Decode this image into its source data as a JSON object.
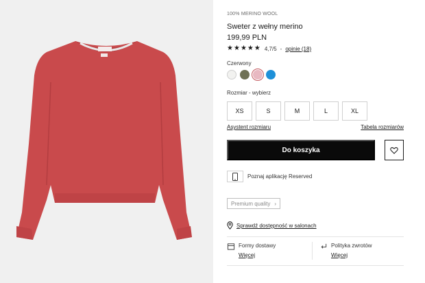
{
  "product": {
    "collection": "100% MERINO WOOL",
    "title": "Sweter z wełny merino",
    "price": "199,99 PLN",
    "rating": {
      "stars": 5,
      "score": "4,7/5",
      "separator": "-",
      "reviews_link": "opinie (18)"
    },
    "color_label": "Czerwony",
    "colors": [
      {
        "name": "white",
        "hex": "#f2f2f0"
      },
      {
        "name": "olive",
        "hex": "#6f7155"
      },
      {
        "name": "pink",
        "hex": "#e8b9c2",
        "selected": true
      },
      {
        "name": "blue",
        "hex": "#1e90d8"
      }
    ],
    "size_label": "Rozmiar -  wybierz",
    "sizes": [
      "XS",
      "S",
      "M",
      "L",
      "XL"
    ],
    "size_assistant_link": "Asystent rozmiaru",
    "size_table_link": "Tabela rozmiarów",
    "add_to_cart": "Do koszyka",
    "app_promo": "Poznaj aplikację Reserved",
    "premium_badge": "Premium quality",
    "store_availability": "Sprawdź dostępność w salonach",
    "delivery": {
      "title": "Formy dostawy",
      "link": "Więcej"
    },
    "returns": {
      "title": "Polityka zwrotów",
      "link": "Więcej"
    }
  },
  "colors": {
    "sweater": "#c94a4c",
    "sweater_shadow": "#b33d40",
    "button_bg": "#0a0a0a",
    "panel_bg": "#f0f0f0"
  }
}
